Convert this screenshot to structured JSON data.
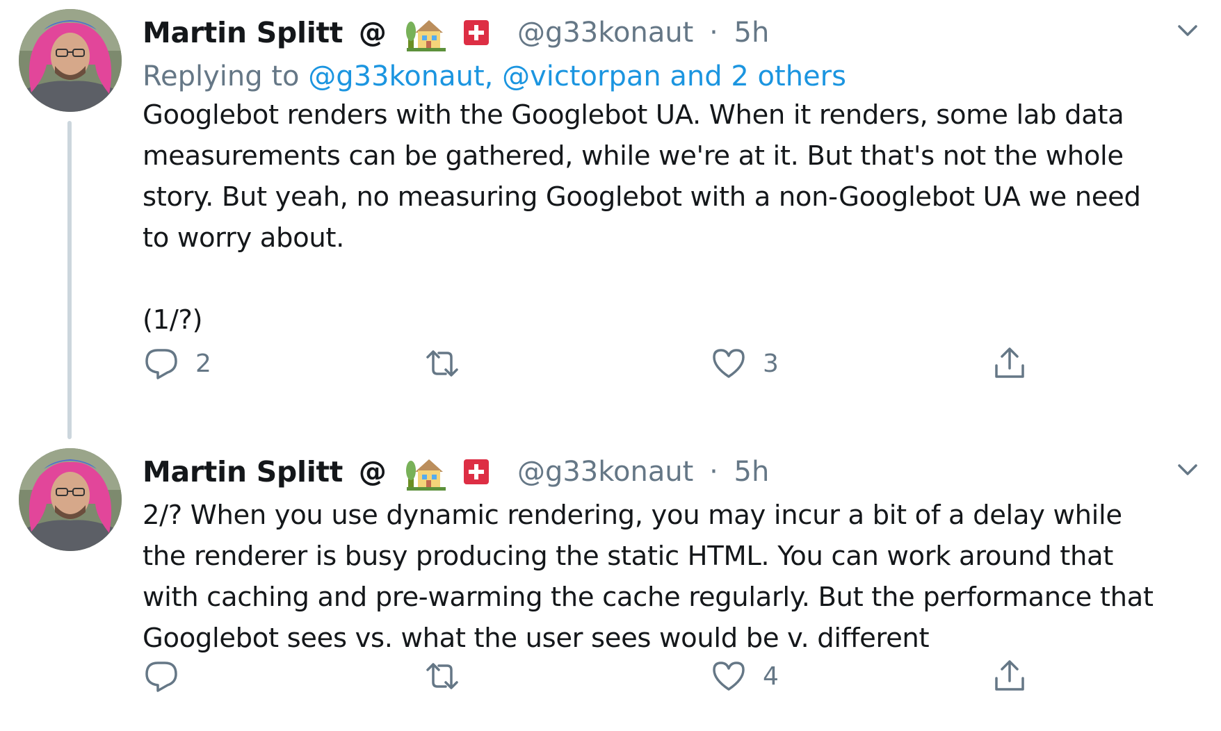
{
  "tweets": [
    {
      "author_name": "Martin Splitt",
      "author_suffix": "@",
      "handle": "@g33konaut",
      "separator": "·",
      "time": "5h",
      "replying_prefix": "Replying to ",
      "replying_mentions": "@g33konaut, @victorpan and 2 others",
      "text": "Googlebot renders with the Googlebot UA. When it renders, some lab data\nmeasurements can be gathered, while we're at it. But that's not the whole\nstory. But yeah, no measuring Googlebot with a non-Googlebot UA we need\nto worry about.\n\n(1/?)",
      "reply_count": "2",
      "retweet_count": "",
      "like_count": "3"
    },
    {
      "author_name": "Martin Splitt",
      "author_suffix": "@",
      "handle": "@g33konaut",
      "separator": "·",
      "time": "5h",
      "text": "2/? When you use dynamic rendering, you may incur a bit of a delay while\nthe renderer is busy producing the static HTML. You can work around that\nwith caching and pre-warming the cache regularly. But the performance that\nGooglebot sees vs. what the user sees would be v. different",
      "reply_count": "",
      "retweet_count": "",
      "like_count": "4"
    }
  ],
  "icons": {
    "reply": "reply-icon",
    "retweet": "retweet-icon",
    "like": "heart-icon",
    "share": "share-icon",
    "more": "chevron-down-icon",
    "house": "house-with-garden-emoji",
    "flag": "swiss-flag-emoji"
  },
  "colors": {
    "text": "#14171a",
    "secondary": "#657786",
    "link": "#1b95e0",
    "thread_line": "#ccd6dd"
  }
}
